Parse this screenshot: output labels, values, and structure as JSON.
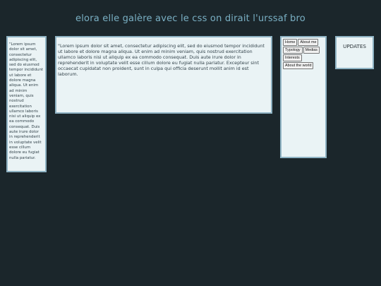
{
  "header": {
    "title": "elora elle galère avec le css on dirait l'urssaf bro"
  },
  "sidebar": {
    "text": "\"Lorem ipsum dolor sit amet, consectetur adipiscing elit, sed do eiusmod tempor incididunt ut labore et dolore magna aliqua. Ut enim ad minim veniam, quis nostrud exercitation ullamco laboris nisi ut aliquip ex ea commodo consequat. Duis aute irure dolor in reprehenderit in voluptate velit esse cillum dolore eu fugiat nulla pariatur."
  },
  "main": {
    "text": "\"Lorem ipsum dolor sit amet, consectetur adipiscing elit, sed do eiusmod tempor incididunt ut labore et dolore magna aliqua. Ut enim ad minim veniam, quis nostrud exercitation ullamco laboris nisi ut aliquip ex ea commodo consequat. Duis aute irure dolor in reprehenderit in voluptate velit esse cillum dolore eu fugiat nulla pariatur. Excepteur sint occaecat cupidatat non proident, sunt in culpa qui officia deserunt mollit anim id est laborum."
  },
  "nav": {
    "buttons": [
      {
        "label": "Home"
      },
      {
        "label": "About me"
      },
      {
        "label": "Typology"
      },
      {
        "label": "Medias"
      },
      {
        "label": "Interests"
      },
      {
        "label": "About the world"
      }
    ]
  },
  "updates": {
    "label": "UPDATES"
  },
  "colors": {
    "background": "#1b262b",
    "title": "#7ab0c4",
    "panel": "#eaf3f5",
    "panel_border": "#8fb3c4"
  }
}
